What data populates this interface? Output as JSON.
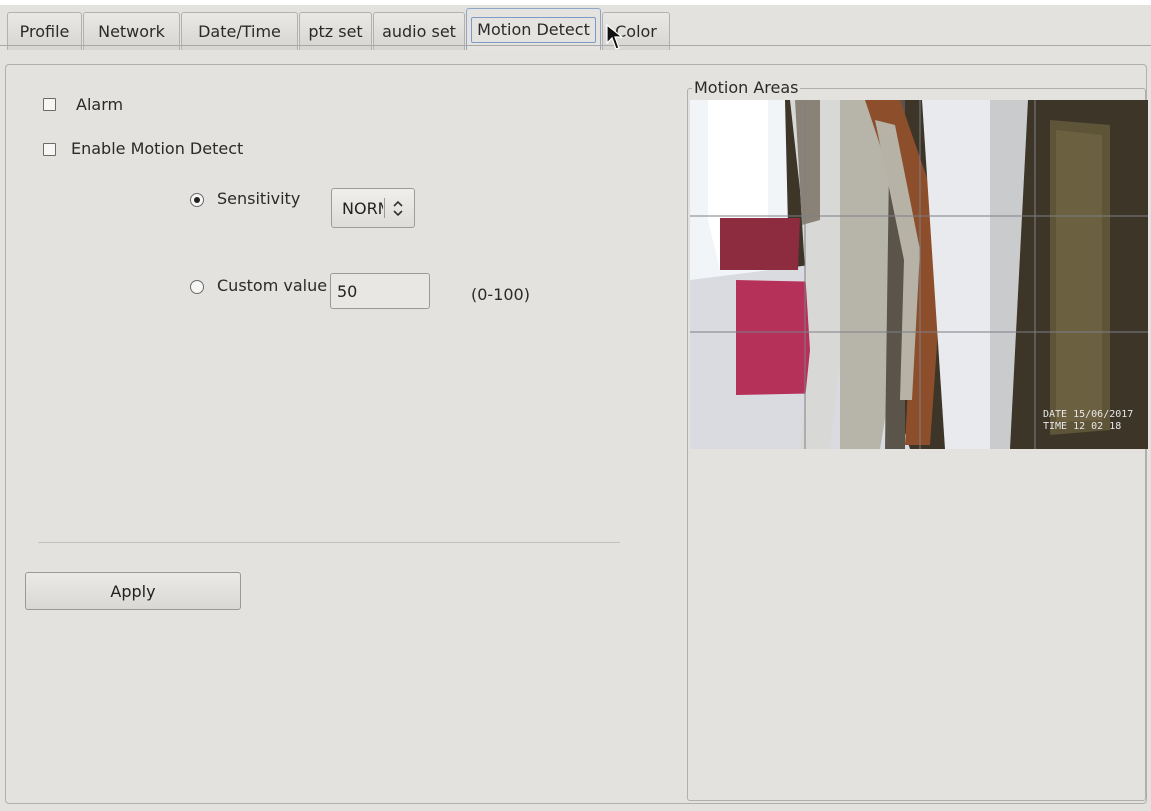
{
  "tabs": [
    {
      "label": "Profile",
      "active": false
    },
    {
      "label": "Network",
      "active": false
    },
    {
      "label": "Date/Time",
      "active": false
    },
    {
      "label": "ptz set",
      "active": false
    },
    {
      "label": "audio set",
      "active": false
    },
    {
      "label": "Motion Detect",
      "active": true
    },
    {
      "label": "Color",
      "active": false
    }
  ],
  "settings": {
    "alarm_label": "Alarm",
    "alarm_checked": false,
    "enable_label": "Enable Motion Detect",
    "enable_checked": false,
    "sensitivity_label": "Sensitivity",
    "sensitivity_selected": true,
    "sensitivity_value": "NORMAL",
    "custom_label": "Custom value",
    "custom_selected": false,
    "custom_value": "50",
    "custom_range": "(0-100)",
    "apply_label": "Apply"
  },
  "motion_areas": {
    "title": "Motion Areas",
    "grid_columns": 4,
    "grid_rows": 3,
    "osd_date": "DATE 15/06/2017",
    "osd_time": "TIME 12 02 18"
  },
  "icons": {
    "combo_arrow": "chevron-up-down-icon",
    "cursor": "mouse-pointer-icon"
  },
  "colors": {
    "background": "#e3e2df",
    "active_tab_border": "#7d9bc4",
    "mat": "#b6315a"
  }
}
